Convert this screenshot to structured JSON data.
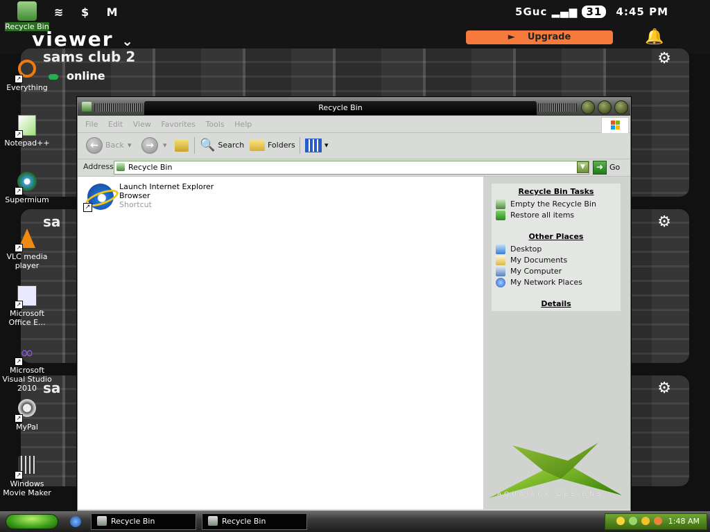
{
  "phone": {
    "status_left": "≋ $ M",
    "network": "5Guc",
    "battery": "31",
    "time": "4:45 PM",
    "viewer_title": "viewer",
    "upgrade_label": "Upgrade",
    "camera_title": "sams club 2",
    "camera_title_short": "sa",
    "online_label": "online"
  },
  "desktop": {
    "icons": [
      {
        "label": "Recycle Bin"
      },
      {
        "label": "Everything"
      },
      {
        "label": "Notepad++"
      },
      {
        "label": "Supermium"
      },
      {
        "label": "VLC media player"
      },
      {
        "label": "Microsoft Office E..."
      },
      {
        "label": "Microsoft Visual Studio 2010"
      },
      {
        "label": "MyPal"
      },
      {
        "label": "Windows Movie Maker"
      }
    ]
  },
  "window": {
    "title": "Recycle Bin",
    "menu": [
      "File",
      "Edit",
      "View",
      "Favorites",
      "Tools",
      "Help"
    ],
    "toolbar": {
      "back": "Back",
      "search": "Search",
      "folders": "Folders"
    },
    "address": {
      "label": "Address",
      "value": "Recycle Bin",
      "go": "Go"
    },
    "file": {
      "name_line1": "Launch Internet Explorer",
      "name_line2": "Browser",
      "type": "Shortcut"
    },
    "tasks": {
      "section1_title": "Recycle Bin Tasks",
      "section1_items": [
        "Empty the Recycle Bin",
        "Restore all items"
      ],
      "section2_title": "Other Places",
      "section2_items": [
        "Desktop",
        "My Documents",
        "My Computer",
        "My Network Places"
      ],
      "section3_title": "Details"
    },
    "brand": "AQUAJACK DESIGNS"
  },
  "taskbar": {
    "buttons": [
      "Recycle Bin",
      "Recycle Bin"
    ],
    "clock": "1:48 AM"
  },
  "colors": {
    "accent_green": "#3da01a",
    "upgrade_orange": "#f57a3c",
    "online_green": "#23b04e"
  }
}
